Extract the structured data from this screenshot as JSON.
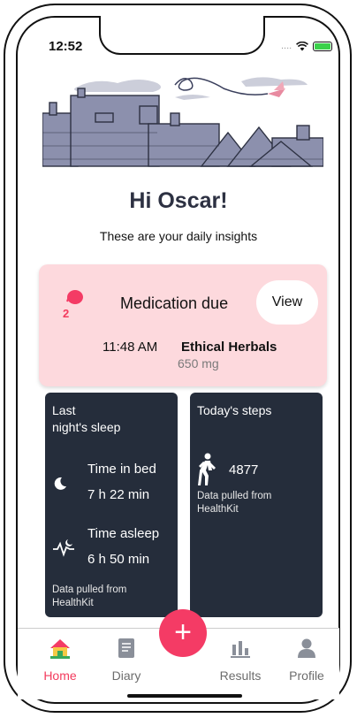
{
  "status_bar": {
    "time": "12:52",
    "signal": "....",
    "wifi_icon": "wifi-icon",
    "battery_icon": "battery-charging-icon"
  },
  "header": {
    "illustration": "rooftops-and-bird-illustration",
    "greeting": "Hi Oscar!",
    "subtitle": "These are your daily insights"
  },
  "medication": {
    "icon": "pill-icon",
    "count": "2",
    "title": "Medication due",
    "view_label": "View",
    "time": "11:48 AM",
    "name": "Ethical Herbals",
    "dose": "650 mg",
    "card_color": "#fdd9dd"
  },
  "sleep": {
    "title_line1": "Last",
    "title_line2": "night's sleep",
    "time_in_bed_label": "Time in bed",
    "time_in_bed_value": "7 h 22 min",
    "time_asleep_label": "Time asleep",
    "time_asleep_value": "6 h 50 min",
    "note_line1": "Data pulled from",
    "note_line2": "HealthKit"
  },
  "steps": {
    "title": "Today's steps",
    "count": "4877",
    "note_line1": "Data pulled from",
    "note_line2": "HealthKit"
  },
  "fab": {
    "label": "+",
    "color": "#f43b65"
  },
  "tabs": [
    {
      "label": "Home",
      "icon": "home-icon",
      "active": true
    },
    {
      "label": "Diary",
      "icon": "diary-icon",
      "active": false
    },
    {
      "label": "Results",
      "icon": "results-icon",
      "active": false
    },
    {
      "label": "Profile",
      "icon": "profile-icon",
      "active": false
    }
  ],
  "colors": {
    "accent": "#f33b5d",
    "dark_card": "#252d3b",
    "heading": "#2d3142"
  }
}
